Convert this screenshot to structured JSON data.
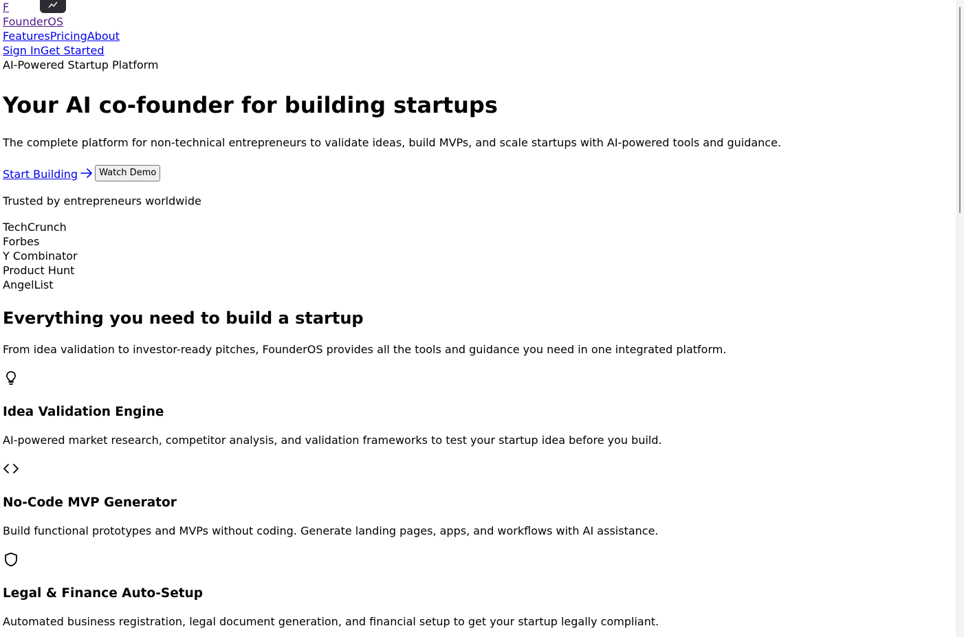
{
  "nav": {
    "logo_letter": "F",
    "brand_name": "FounderOS",
    "links": [
      "Features",
      "Pricing",
      "About"
    ],
    "sign_in": "Sign In",
    "get_started": "Get Started"
  },
  "hero": {
    "badge": "AI-Powered Startup Platform",
    "title": "Your AI co-founder for building startups",
    "subtitle": "The complete platform for non-technical entrepreneurs to validate ideas, build MVPs, and scale startups with AI-powered tools and guidance.",
    "primary_cta": "Start Building ",
    "secondary_cta": "Watch Demo"
  },
  "trusted": {
    "label": "Trusted by entrepreneurs worldwide",
    "logos": [
      "TechCrunch",
      "Forbes",
      "Y Combinator",
      "Product Hunt",
      "AngelList"
    ]
  },
  "features": {
    "title": "Everything you need to build a startup",
    "subtitle": "From idea validation to investor-ready pitches, FounderOS provides all the tools and guidance you need in one integrated platform.",
    "items": [
      {
        "icon": "lightbulb-icon",
        "title": "Idea Validation Engine",
        "description": "AI-powered market research, competitor analysis, and validation frameworks to test your startup idea before you build."
      },
      {
        "icon": "code-icon",
        "title": "No-Code MVP Generator",
        "description": "Build functional prototypes and MVPs without coding. Generate landing pages, apps, and workflows with AI assistance."
      },
      {
        "icon": "shield-icon",
        "title": "Legal & Finance Auto-Setup",
        "description": "Automated business registration, legal document generation, and financial setup to get your startup legally compliant."
      }
    ]
  },
  "colors": {
    "link": "#0000ee",
    "visited_link": "#551a8b",
    "text": "#000000",
    "widget_bg": "#2c2d33"
  }
}
